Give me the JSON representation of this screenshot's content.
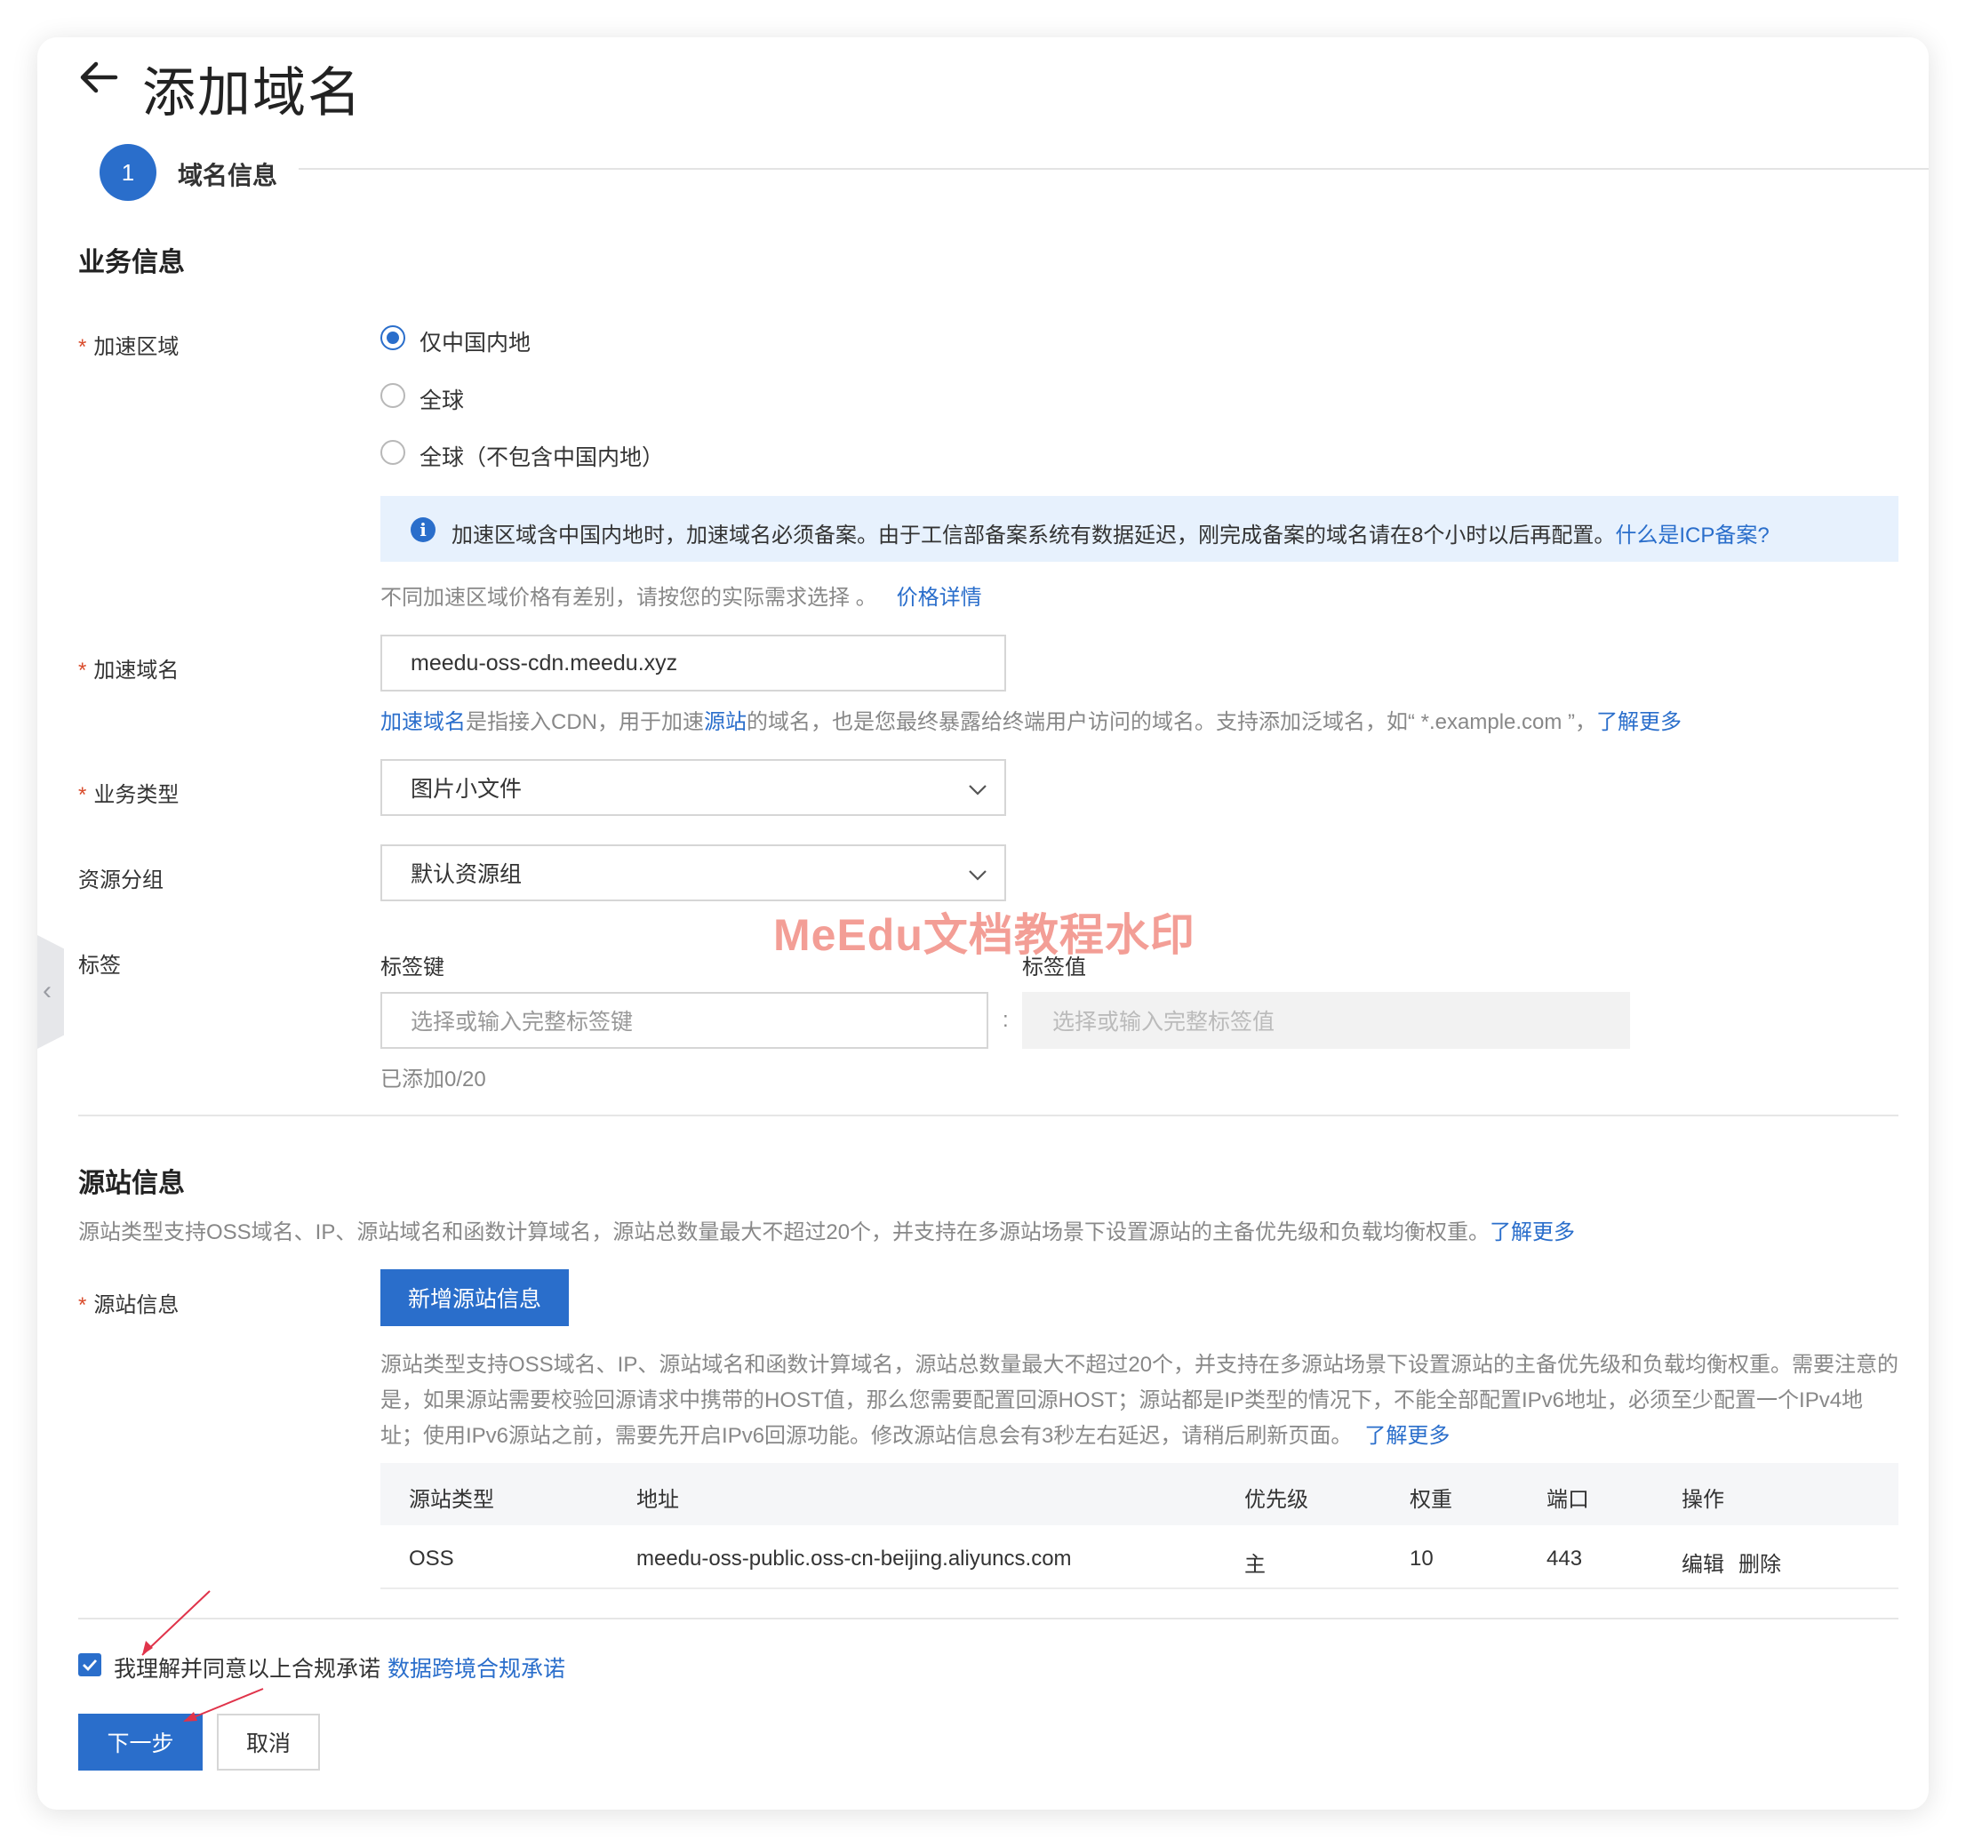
{
  "header": {
    "title": "添加域名",
    "step_number": "1",
    "step_label": "域名信息"
  },
  "business": {
    "section_title": "业务信息",
    "region_label": "加速区域",
    "region_options": [
      "仅中国内地",
      "全球",
      "全球（不包含中国内地）"
    ],
    "region_selected": "仅中国内地",
    "info_text": "加速区域含中国内地时，加速域名必须备案。由于工信部备案系统有数据延迟，刚完成备案的域名请在8个小时以后再配置。",
    "info_link": "什么是ICP备案?",
    "price_hint": "不同加速区域价格有差别，请按您的实际需求选择 。",
    "price_link": "价格详情",
    "domain_label": "加速域名",
    "domain_value": "meedu-oss-cdn.meedu.xyz",
    "domain_hint_link1": "加速域名",
    "domain_hint_part1": "是指接入CDN，用于加速",
    "domain_hint_link2": "源站",
    "domain_hint_part2": "的域名，也是您最终暴露给终端用户访问的域名。支持添加泛域名，如“ *.example.com ”，",
    "domain_hint_link3": "了解更多",
    "type_label": "业务类型",
    "type_value": "图片小文件",
    "group_label": "资源分组",
    "group_value": "默认资源组",
    "tag_label": "标签",
    "tag_key_label": "标签键",
    "tag_value_label": "标签值",
    "tag_key_placeholder": "选择或输入完整标签键",
    "tag_value_placeholder": "选择或输入完整标签值",
    "tag_separator": ":",
    "tag_count": "已添加0/20"
  },
  "origin": {
    "section_title": "源站信息",
    "desc": "源站类型支持OSS域名、IP、源站域名和函数计算域名，源站总数量最大不超过20个，并支持在多源站场景下设置源站的主备优先级和负载均衡权重。",
    "desc_link": "了解更多",
    "field_label": "源站信息",
    "add_button": "新增源站信息",
    "note_line1": "源站类型支持OSS域名、IP、源站域名和函数计算域名，源站总数量最大不超过20个，并支持在多源站场景下设置源站的主备优先级和负载均衡权重。需要注意的",
    "note_line2": "是，如果源站需要校验回源请求中携带的HOST值，那么您需要配置回源HOST；源站都是IP类型的情况下，不能全部配置IPv6地址，必须至少配置一个IPv4地",
    "note_line3": "址；使用IPv6源站之前，需要先开启IPv6回源功能。修改源站信息会有3秒左右延迟，请稍后刷新页面。",
    "note_link": "了解更多",
    "table": {
      "headers": [
        "源站类型",
        "地址",
        "优先级",
        "权重",
        "端口",
        "操作"
      ],
      "rows": [
        {
          "type": "OSS",
          "address": "meedu-oss-public.oss-cn-beijing.aliyuncs.com",
          "priority": "主",
          "weight": "10",
          "port": "443",
          "edit": "编辑",
          "delete": "删除"
        }
      ]
    }
  },
  "footer": {
    "agree_text": "我理解并同意以上合规承诺",
    "agree_link": "数据跨境合规承诺",
    "agree_checked": true,
    "next_button": "下一步",
    "cancel_button": "取消"
  },
  "watermark": "MeEdu文档教程水印",
  "colors": {
    "primary": "#2a6ecb",
    "info_bg": "#e7f1fd",
    "required": "#d94b2b",
    "watermark": "#ee786e"
  }
}
